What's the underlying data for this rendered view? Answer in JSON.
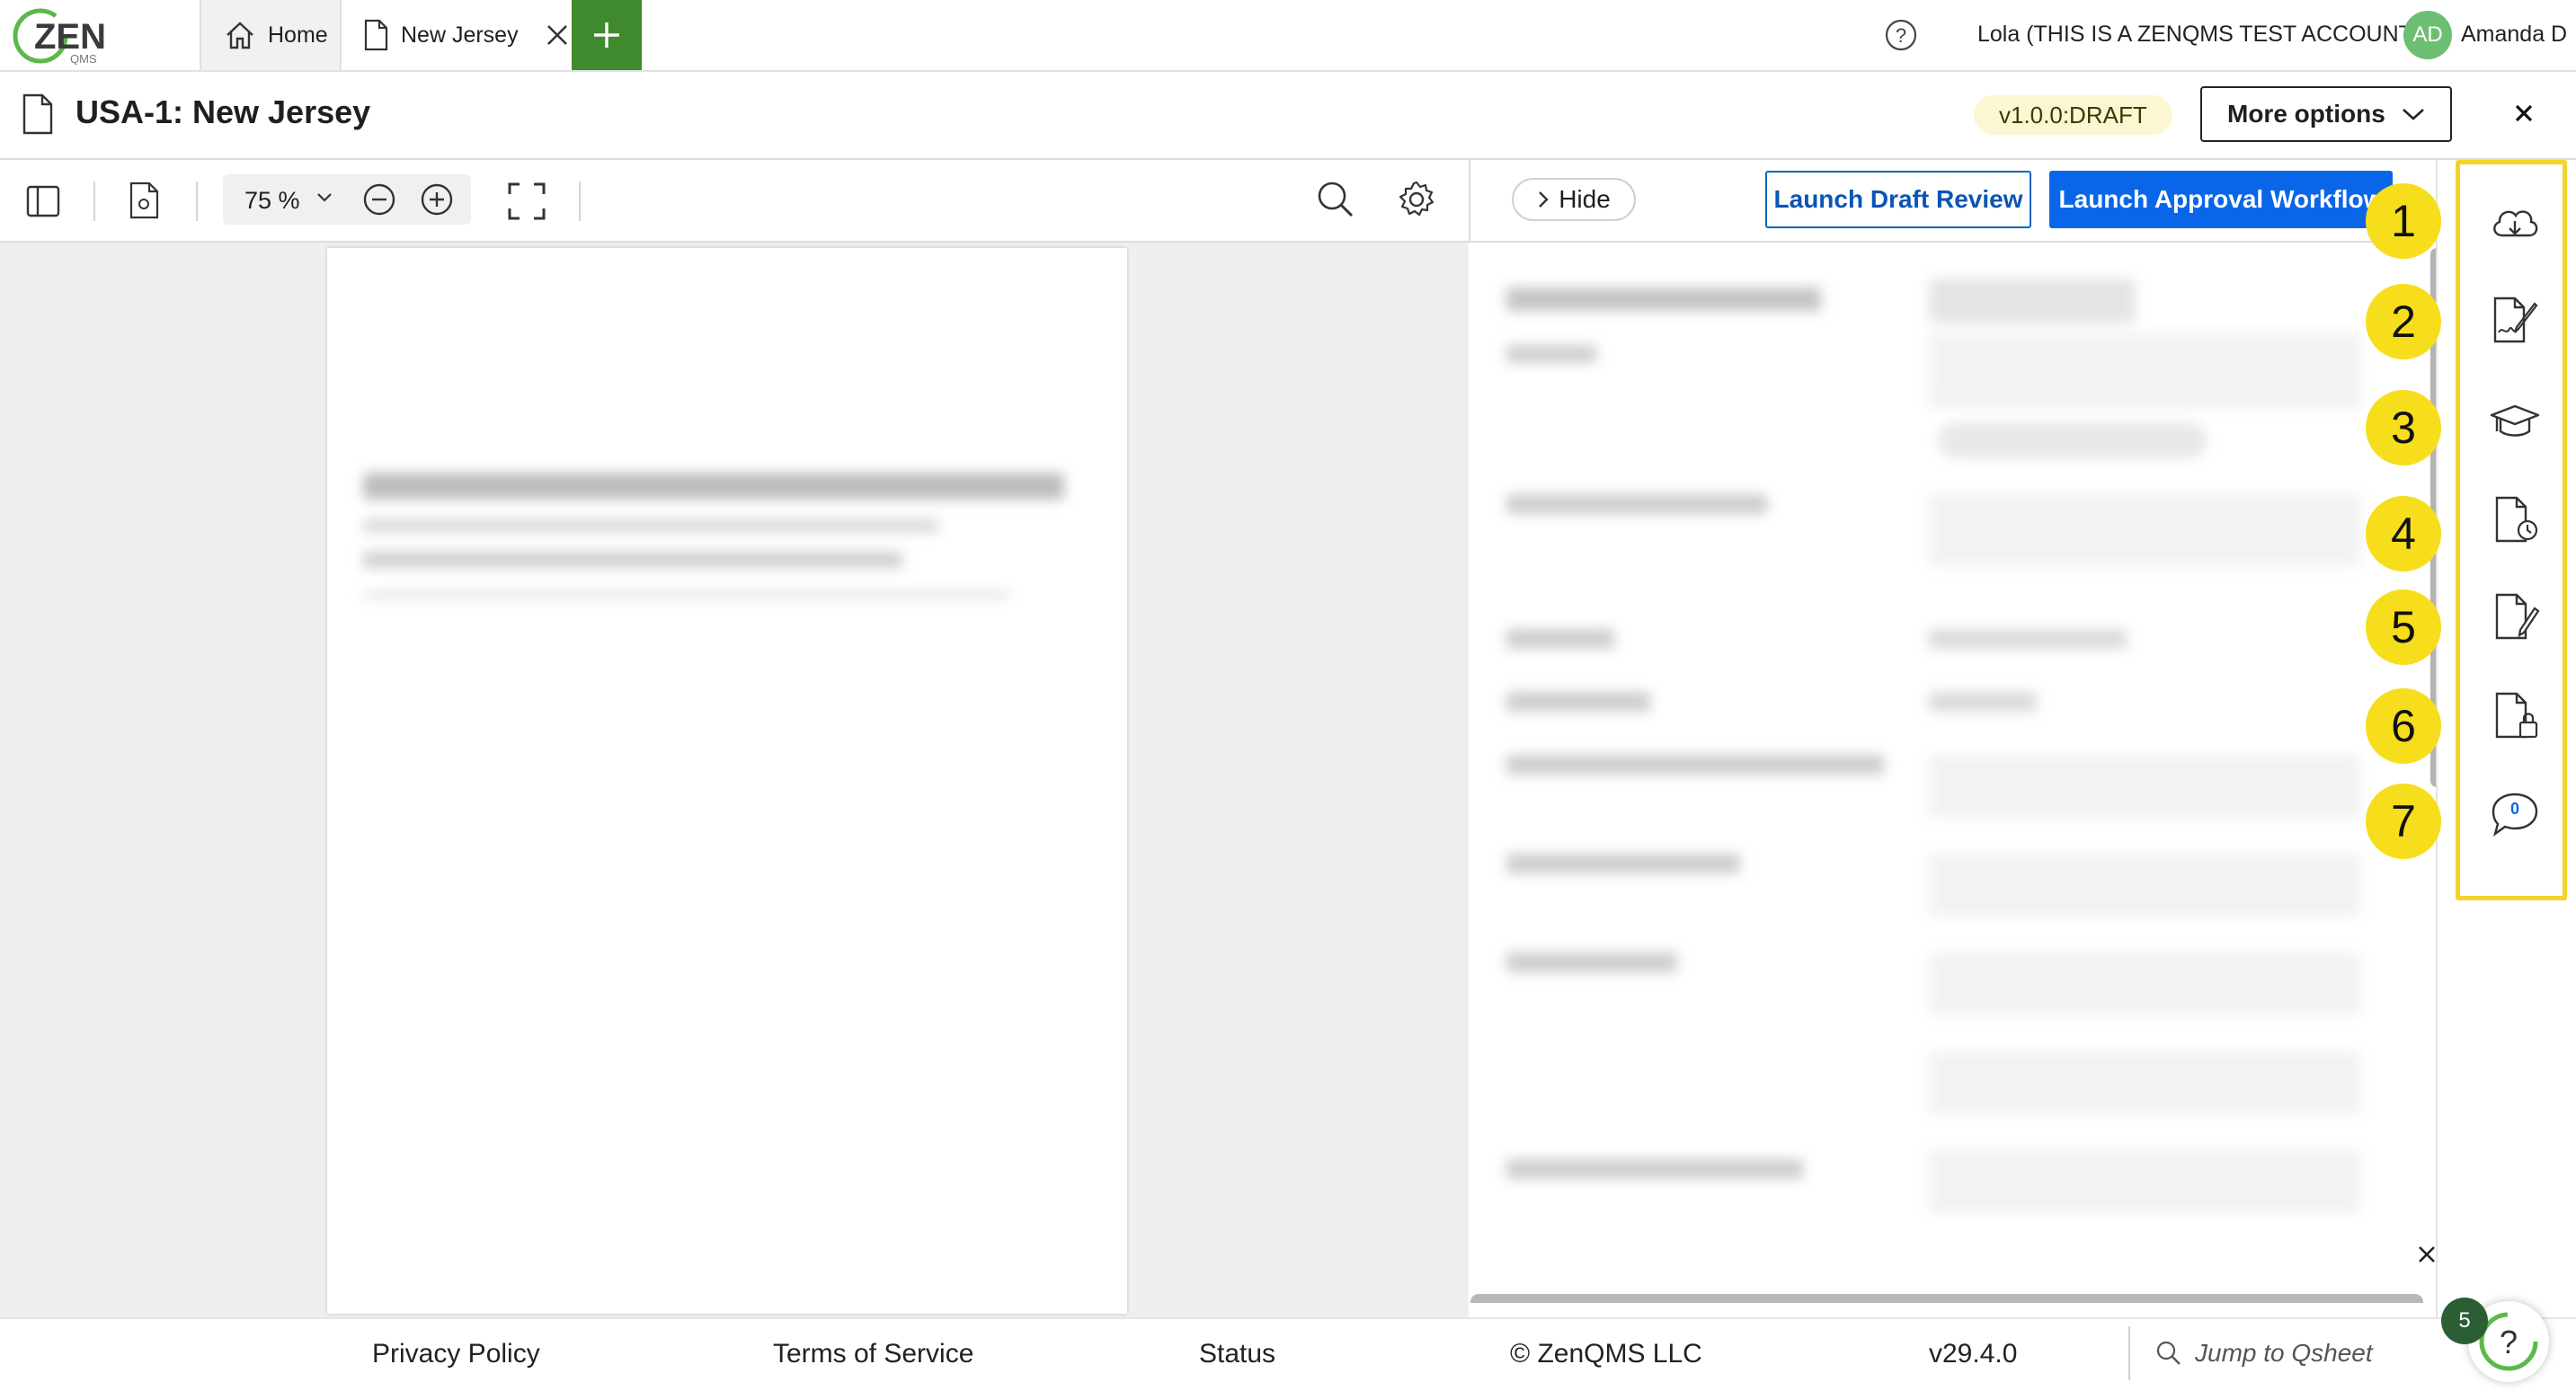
{
  "app": {
    "logo_text": "ZEN",
    "logo_sub": "QMS"
  },
  "tabs": [
    {
      "label": "Home",
      "icon": "home-icon"
    },
    {
      "label": "New Jersey",
      "icon": "document-icon"
    }
  ],
  "user": {
    "account": "Lola (THIS IS A ZENQMS TEST ACCOUNT)",
    "initials": "AD",
    "name": "Amanda D"
  },
  "header": {
    "title": "USA-1: New Jersey",
    "version": "v1.0.0:DRAFT",
    "more_options": "More options"
  },
  "viewer_toolbar": {
    "zoom": "75 %"
  },
  "panel_toolbar": {
    "hide_label": "Hide",
    "draft_review": "Launch Draft Review",
    "approval_workflow": "Launch Approval Workflow"
  },
  "side_rail": {
    "markers": [
      "1",
      "2",
      "3",
      "4",
      "5",
      "6",
      "7"
    ],
    "icons": [
      "cloud-download-icon",
      "signature-icon",
      "graduation-cap-icon",
      "document-history-icon",
      "document-edit-icon",
      "document-lock-icon",
      "comment-icon"
    ],
    "comment_count": "0"
  },
  "footer": {
    "privacy": "Privacy Policy",
    "terms": "Terms of Service",
    "status": "Status",
    "copyright": "© ZenQMS LLC",
    "version": "v29.4.0",
    "search_placeholder": "Jump to Qsheet"
  },
  "help_widget": {
    "badge": "5"
  },
  "colors": {
    "primary": "#0a66e8",
    "add_tab": "#3f8a2c",
    "highlight": "#f3d42c",
    "draft_badge": "#fbf7d2"
  }
}
